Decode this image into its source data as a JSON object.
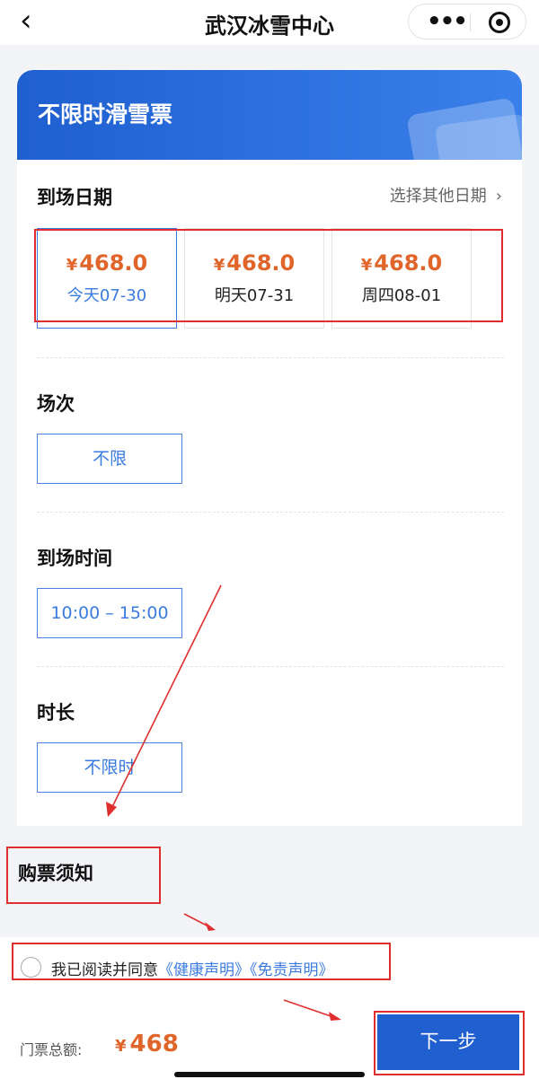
{
  "nav": {
    "back_icon": "‹",
    "title": "武汉冰雪中心",
    "more_icon": "•••"
  },
  "ticket": {
    "name": "不限时滑雪票"
  },
  "date_section": {
    "title": "到场日期",
    "other_dates": "选择其他日期",
    "chevron": "›",
    "options": [
      {
        "currency": "¥",
        "price": "468.0",
        "date": "今天07-30",
        "selected": true
      },
      {
        "currency": "¥",
        "price": "468.0",
        "date": "明天07-31",
        "selected": false
      },
      {
        "currency": "¥",
        "price": "468.0",
        "date": "周四08-01",
        "selected": false
      }
    ]
  },
  "session": {
    "title": "场次",
    "value": "不限"
  },
  "arrival_time": {
    "title": "到场时间",
    "value": "10:00 – 15:00"
  },
  "duration": {
    "title": "时长",
    "value": "不限时"
  },
  "notice": {
    "title": "购票须知"
  },
  "agreement": {
    "text": "我已阅读并同意",
    "health_link": "《健康声明》",
    "disclaimer_link": "《免责声明》"
  },
  "footer": {
    "total_label": "门票总额:",
    "currency": "¥",
    "total_value": "468",
    "next_label": "下一步"
  },
  "colors": {
    "brand_blue": "#1f5fd0",
    "price_orange": "#e0652a",
    "annotation_red": "#e02e2e"
  }
}
